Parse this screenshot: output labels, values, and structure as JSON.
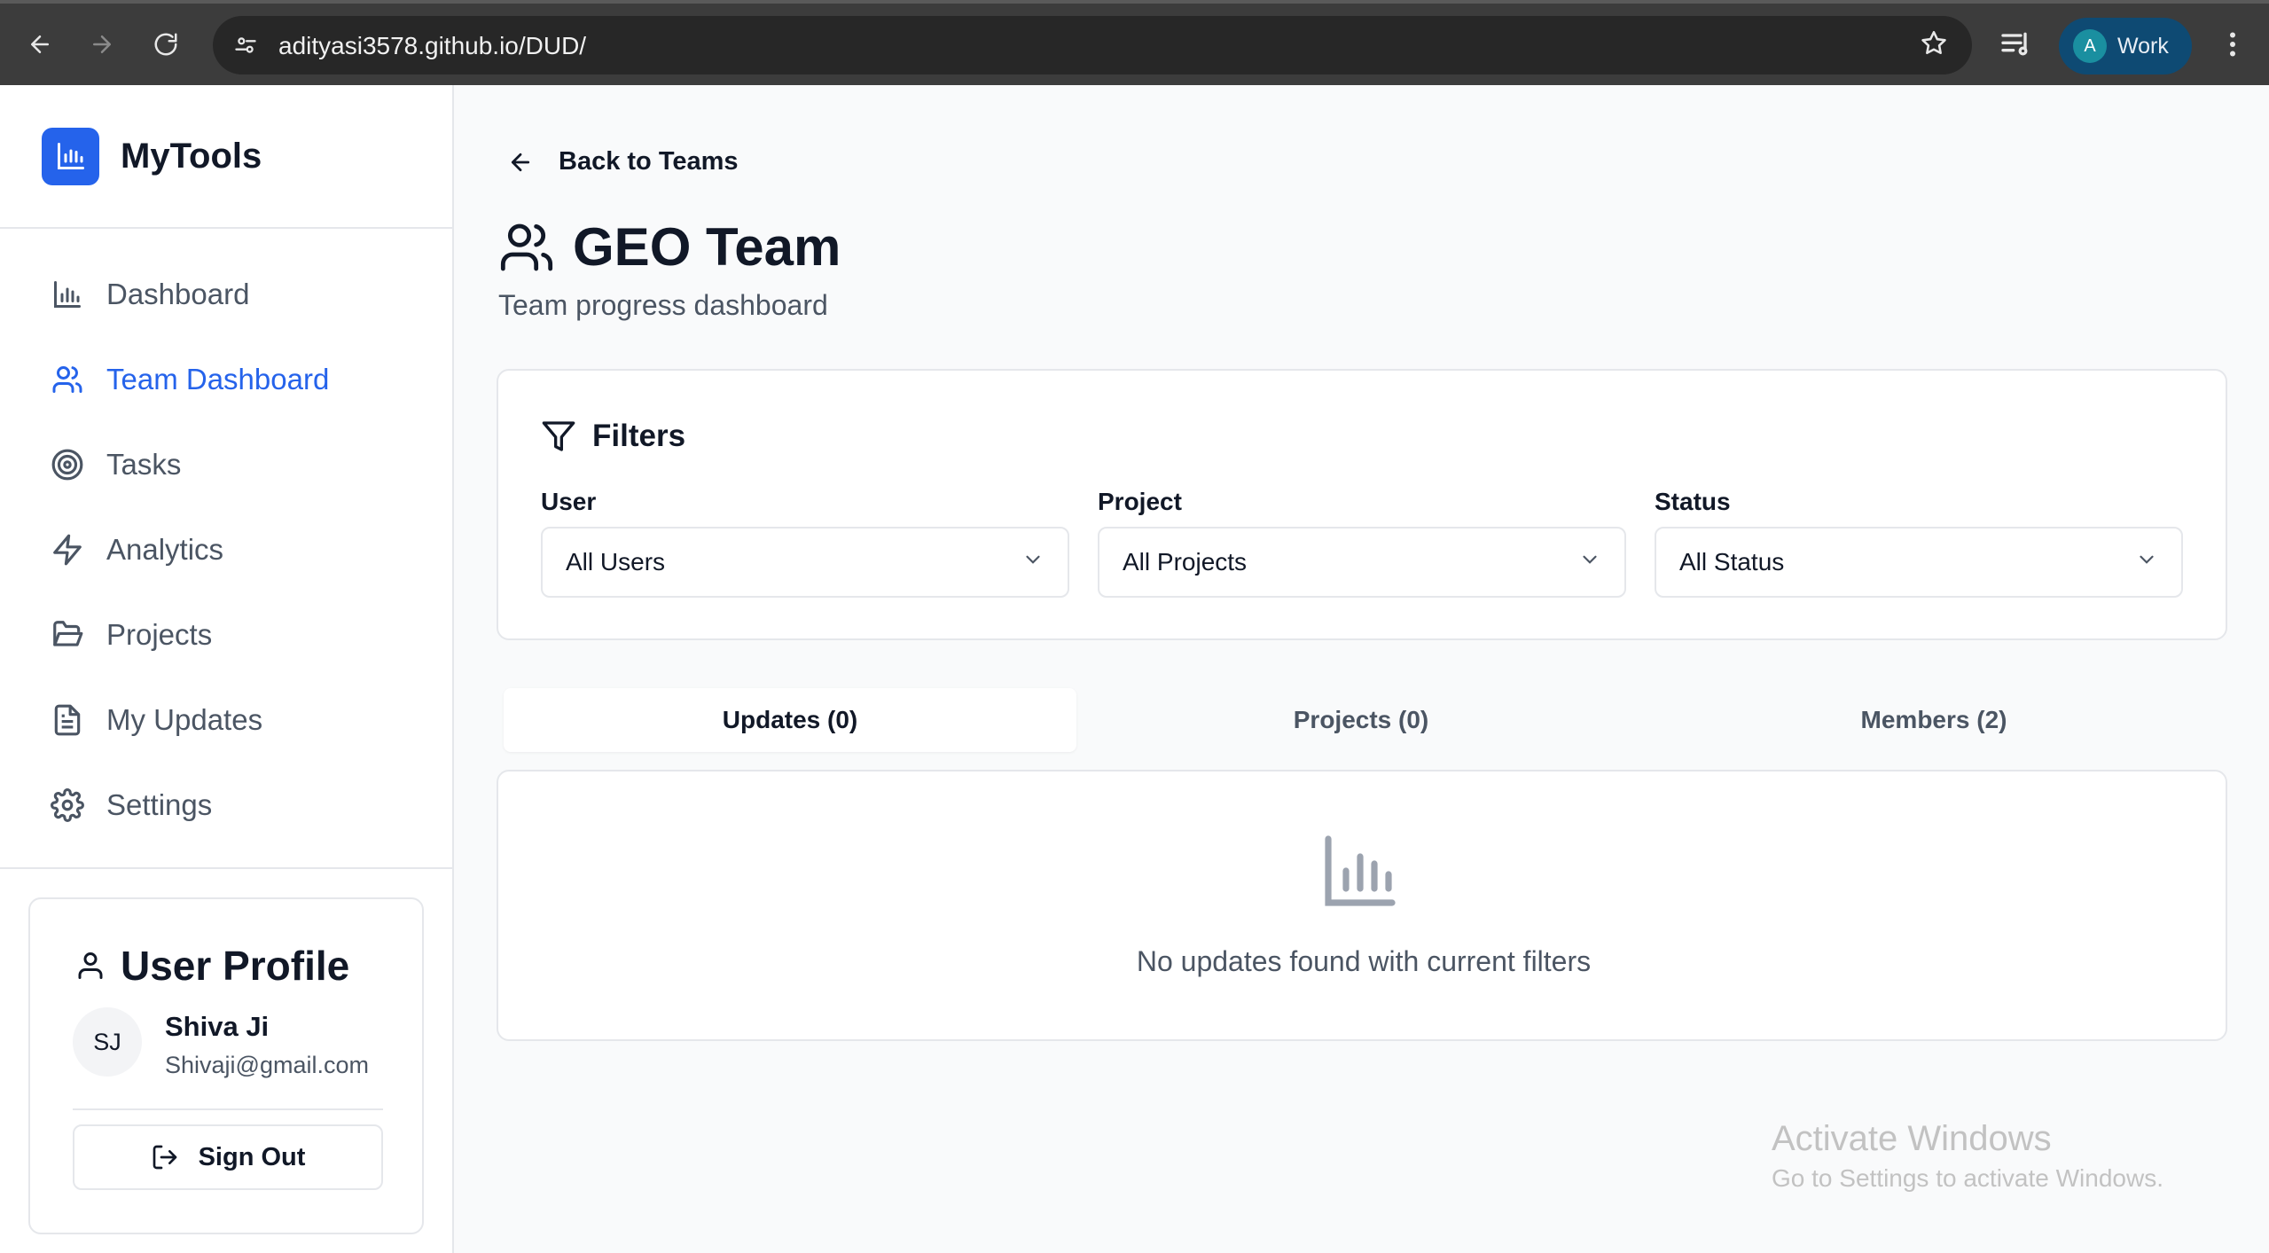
{
  "browser": {
    "url": "adityasi3578.github.io/DUD/",
    "profile_initial": "A",
    "profile_label": "Work"
  },
  "sidebar": {
    "brand": "MyTools",
    "items": [
      {
        "label": "Dashboard",
        "icon": "bar-chart-icon",
        "active": false
      },
      {
        "label": "Team Dashboard",
        "icon": "users-icon",
        "active": true
      },
      {
        "label": "Tasks",
        "icon": "target-icon",
        "active": false
      },
      {
        "label": "Analytics",
        "icon": "zap-icon",
        "active": false
      },
      {
        "label": "Projects",
        "icon": "folder-open-icon",
        "active": false
      },
      {
        "label": "My Updates",
        "icon": "file-text-icon",
        "active": false
      },
      {
        "label": "Settings",
        "icon": "settings-icon",
        "active": false
      }
    ],
    "profile": {
      "title": "User Profile",
      "initials": "SJ",
      "name": "Shiva Ji",
      "email": "Shivaji@gmail.com",
      "sign_out": "Sign Out"
    }
  },
  "main": {
    "back_label": "Back to Teams",
    "title": "GEO Team",
    "subtitle": "Team progress dashboard",
    "filters": {
      "title": "Filters",
      "user": {
        "label": "User",
        "value": "All Users"
      },
      "project": {
        "label": "Project",
        "value": "All Projects"
      },
      "status": {
        "label": "Status",
        "value": "All Status"
      }
    },
    "tabs": [
      {
        "label": "Updates (0)",
        "active": true
      },
      {
        "label": "Projects (0)",
        "active": false
      },
      {
        "label": "Members (2)",
        "active": false
      }
    ],
    "empty_message": "No updates found with current filters"
  },
  "watermark": {
    "line1": "Activate Windows",
    "line2": "Go to Settings to activate Windows."
  },
  "colors": {
    "accent": "#2563eb",
    "text": "#111827",
    "muted": "#4b5563",
    "border": "#e5e7eb"
  }
}
